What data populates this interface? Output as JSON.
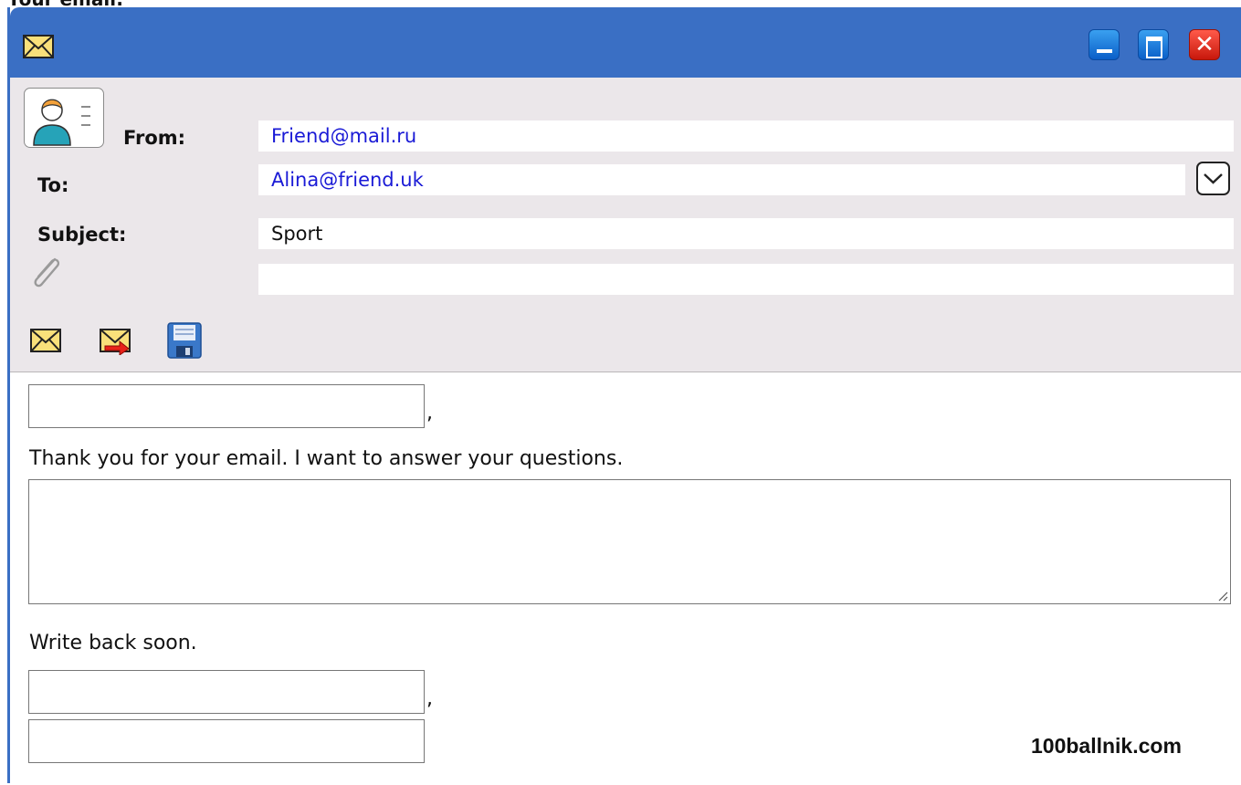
{
  "caption": "Your email:",
  "window": {
    "title_icon": "envelope-icon",
    "controls": [
      "minimize-icon",
      "maximize-icon",
      "close-icon"
    ],
    "close_glyph": "✕"
  },
  "header": {
    "from_label": "From:",
    "from_value": "Friend@mail.ru",
    "to_label": "To:",
    "to_value": "Alina@friend.uk",
    "subject_label": "Subject:",
    "subject_value": "Sport",
    "attachment_value": ""
  },
  "toolbar": [
    "envelope-send-icon",
    "envelope-reply-icon",
    "floppy-save-icon"
  ],
  "body": {
    "greeting_value": "",
    "greeting_comma": ",",
    "intro_text": "Thank you for your email. I want to answer your questions.",
    "answer_value": "",
    "closing_text": "Write back soon.",
    "signoff_value": "",
    "signoff_comma": ",",
    "signature_value": ""
  },
  "watermark": "100ballnik.com",
  "colors": {
    "titlebar": "#3a6fc4",
    "header_bg": "#ebe7ea",
    "link_text": "#1a1ad6",
    "close_button": "#e0281a"
  }
}
